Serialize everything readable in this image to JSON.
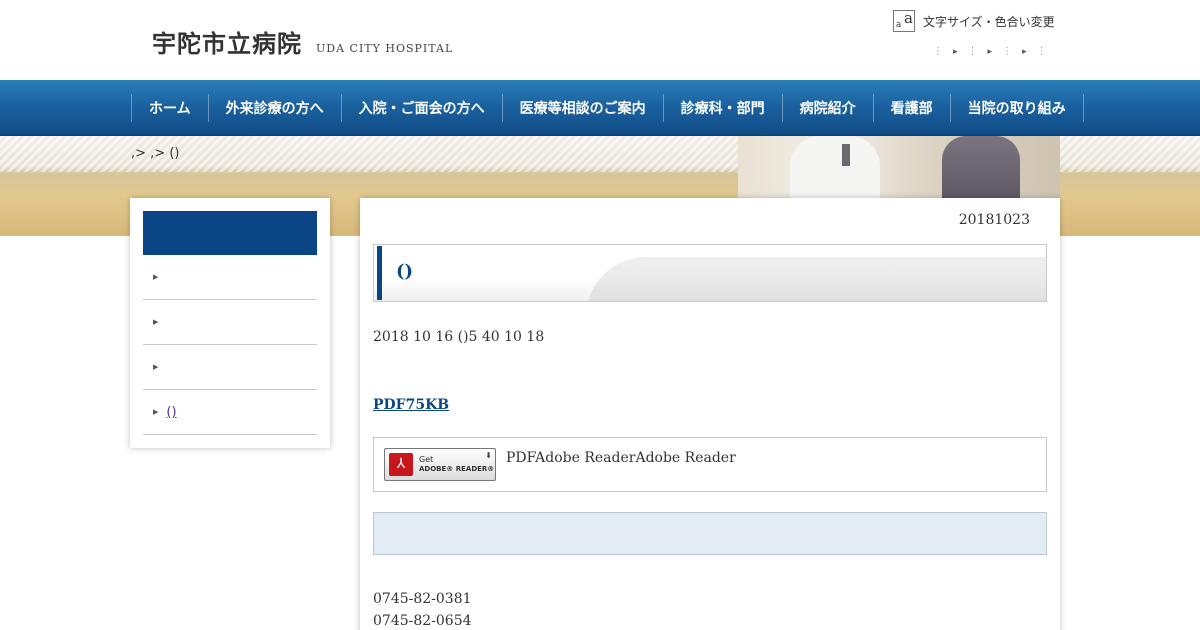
{
  "header": {
    "logo_jp": "宇陀市立病院",
    "logo_en": "UDA CITY HOSPITAL",
    "font_size_label": "文字サイズ・色合い変更",
    "font_size_icon": "font-size-icon",
    "util_links": [
      "▸",
      "▸",
      "▸"
    ]
  },
  "nav": {
    "items": [
      {
        "label": "ホーム"
      },
      {
        "label": "外来診療の方へ"
      },
      {
        "label": "入院・ご面会の方へ"
      },
      {
        "label": "医療等相談のご案内"
      },
      {
        "label": "診療科・部門"
      },
      {
        "label": "病院紹介"
      },
      {
        "label": "看護部"
      },
      {
        "label": "当院の取り組み"
      }
    ]
  },
  "breadcrumb": ",> ,> ()",
  "sidebar": {
    "items": [
      {
        "label": ""
      },
      {
        "label": ""
      },
      {
        "label": ""
      },
      {
        "label": "()"
      }
    ]
  },
  "main": {
    "date": "20181023",
    "title": "()",
    "body": "2018 10 16 ()5 40 10 18",
    "pdf_link": "PDF75KB",
    "adobe_text": "PDFAdobe ReaderAdobe Reader",
    "adobe_badge": {
      "get": "Get",
      "reader": "ADOBE® READER®"
    },
    "tel": [
      "0745-82-0381",
      "0745-82-0654"
    ]
  },
  "colors": {
    "nav_blue": "#1b62a0",
    "accent_navy": "#0a4585",
    "info_bg": "#e3ebf3"
  }
}
